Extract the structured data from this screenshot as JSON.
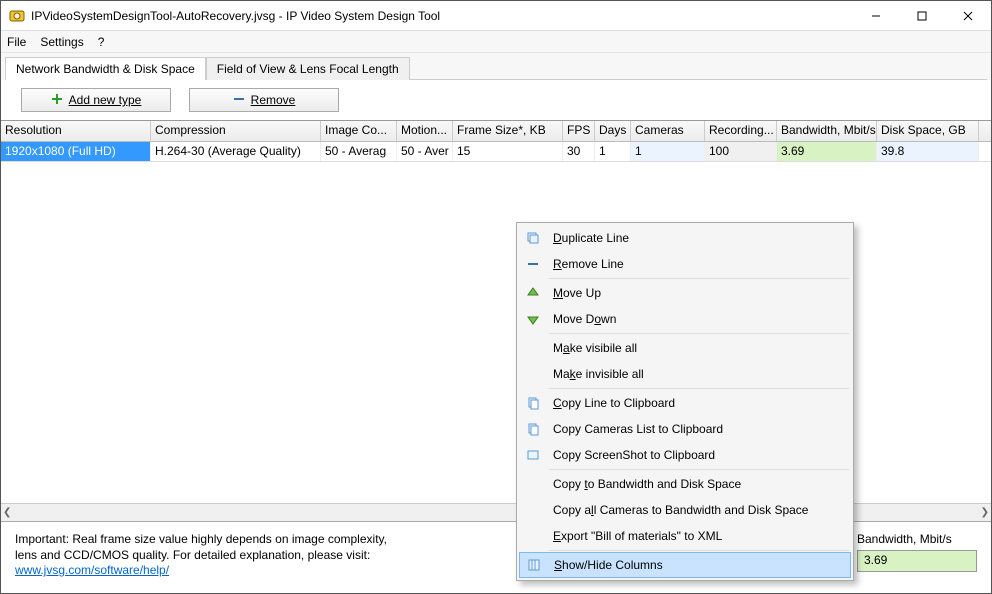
{
  "window": {
    "title": "IPVideoSystemDesignTool-AutoRecovery.jvsg - IP Video System Design Tool"
  },
  "menu": {
    "file": "File",
    "settings": "Settings",
    "help": "?"
  },
  "tabs": {
    "active": "Network Bandwidth & Disk Space",
    "inactive": "Field of View & Lens Focal Length"
  },
  "toolbar": {
    "add": "Add new type",
    "remove": "Remove"
  },
  "columns": {
    "resolution": "Resolution",
    "compression": "Compression",
    "imageco": "Image Co...",
    "motion": "Motion...",
    "frame": "Frame Size*, KB",
    "fps": "FPS",
    "days": "Days",
    "cameras": "Cameras",
    "recording": "Recording...",
    "bandwidth": "Bandwidth, Mbit/s",
    "disk": "Disk Space, GB"
  },
  "row": {
    "resolution": "1920x1080 (Full HD)",
    "compression": "H.264-30 (Average Quality)",
    "imageco": "50 - Averag",
    "motion": "50 - Aver",
    "frame": "15",
    "fps": "30",
    "days": "1",
    "cameras": "1",
    "recording": "100",
    "bandwidth": "3.69",
    "disk": "39.8"
  },
  "contextMenu": {
    "duplicate": "Duplicate Line",
    "remove": "Remove Line",
    "moveUp": "Move Up",
    "moveDown": "Move Down",
    "visibleAll": "Make visibile all",
    "invisibleAll": "Make invisible all",
    "copyLine": "Copy Line to Clipboard",
    "copyCams": "Copy Cameras List to Clipboard",
    "copyShot": "Copy ScreenShot to Clipboard",
    "copyBw": "Copy to Bandwidth and Disk Space",
    "copyAll": "Copy all Cameras to Bandwidth and Disk Space",
    "exportBom": "Export \"Bill of materials\" to XML",
    "showHide": "Show/Hide Columns"
  },
  "footer": {
    "note1": "Important: Real frame size value highly depends on image complexity,",
    "note2": "lens and CCD/CMOS quality. For detailed explanation, please visit:",
    "link": "www.jvsg.com/software/help/",
    "bwLabel": "Bandwidth, Mbit/s",
    "bwValue": "3.69"
  }
}
